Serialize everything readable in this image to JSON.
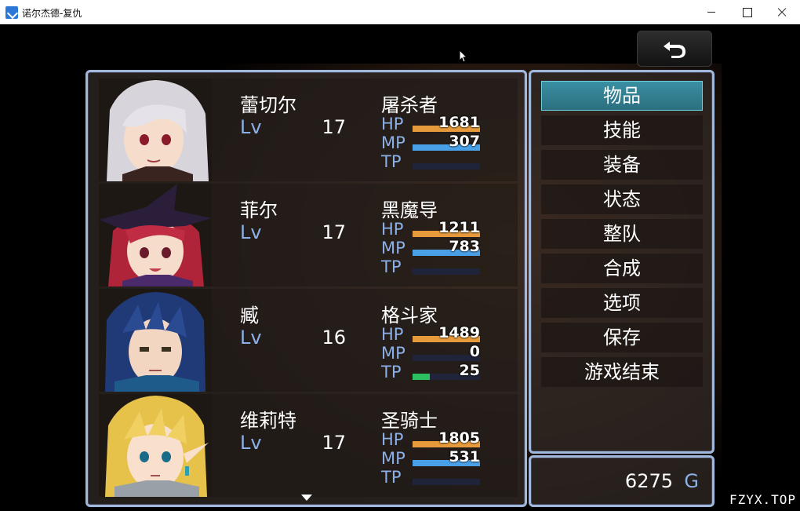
{
  "window": {
    "title": "诺尔杰德-复仇"
  },
  "colors": {
    "hp": "#e69a3c",
    "mp": "#4aa0e6",
    "tp": "#2cc060",
    "accent": "#9fb8dc",
    "system": "#8cb0e8"
  },
  "labels": {
    "lv": "Lv",
    "hp": "HP",
    "mp": "MP",
    "tp": "TP"
  },
  "party": [
    {
      "name": "蕾切尔",
      "level": "17",
      "class": "屠杀者",
      "hp": "1681",
      "mp": "307",
      "tp": "",
      "hp_rate": 1.0,
      "mp_rate": 1.0,
      "tp_rate": 0.0,
      "face": "silver-hair-girl"
    },
    {
      "name": "菲尔",
      "level": "17",
      "class": "黑魔导",
      "hp": "1211",
      "mp": "783",
      "tp": "",
      "hp_rate": 1.0,
      "mp_rate": 1.0,
      "tp_rate": 0.0,
      "face": "red-hair-witch"
    },
    {
      "name": "臧",
      "level": "16",
      "class": "格斗家",
      "hp": "1489",
      "mp": "0",
      "tp": "25",
      "hp_rate": 1.0,
      "mp_rate": 0.0,
      "tp_rate": 0.25,
      "face": "blue-hair-fighter"
    },
    {
      "name": "维莉特",
      "level": "17",
      "class": "圣骑士",
      "hp": "1805",
      "mp": "531",
      "tp": "",
      "hp_rate": 1.0,
      "mp_rate": 1.0,
      "tp_rate": 0.0,
      "face": "blonde-elf"
    }
  ],
  "menu": {
    "items": [
      "物品",
      "技能",
      "装备",
      "状态",
      "整队",
      "合成",
      "选项",
      "保存",
      "游戏结束"
    ],
    "selected": 0
  },
  "gold": {
    "value": "6275",
    "unit": "G"
  },
  "watermark": "FZYX.TOP",
  "icons": {
    "back": "return-arrow-icon",
    "scroll": "scroll-down-arrow-icon"
  }
}
